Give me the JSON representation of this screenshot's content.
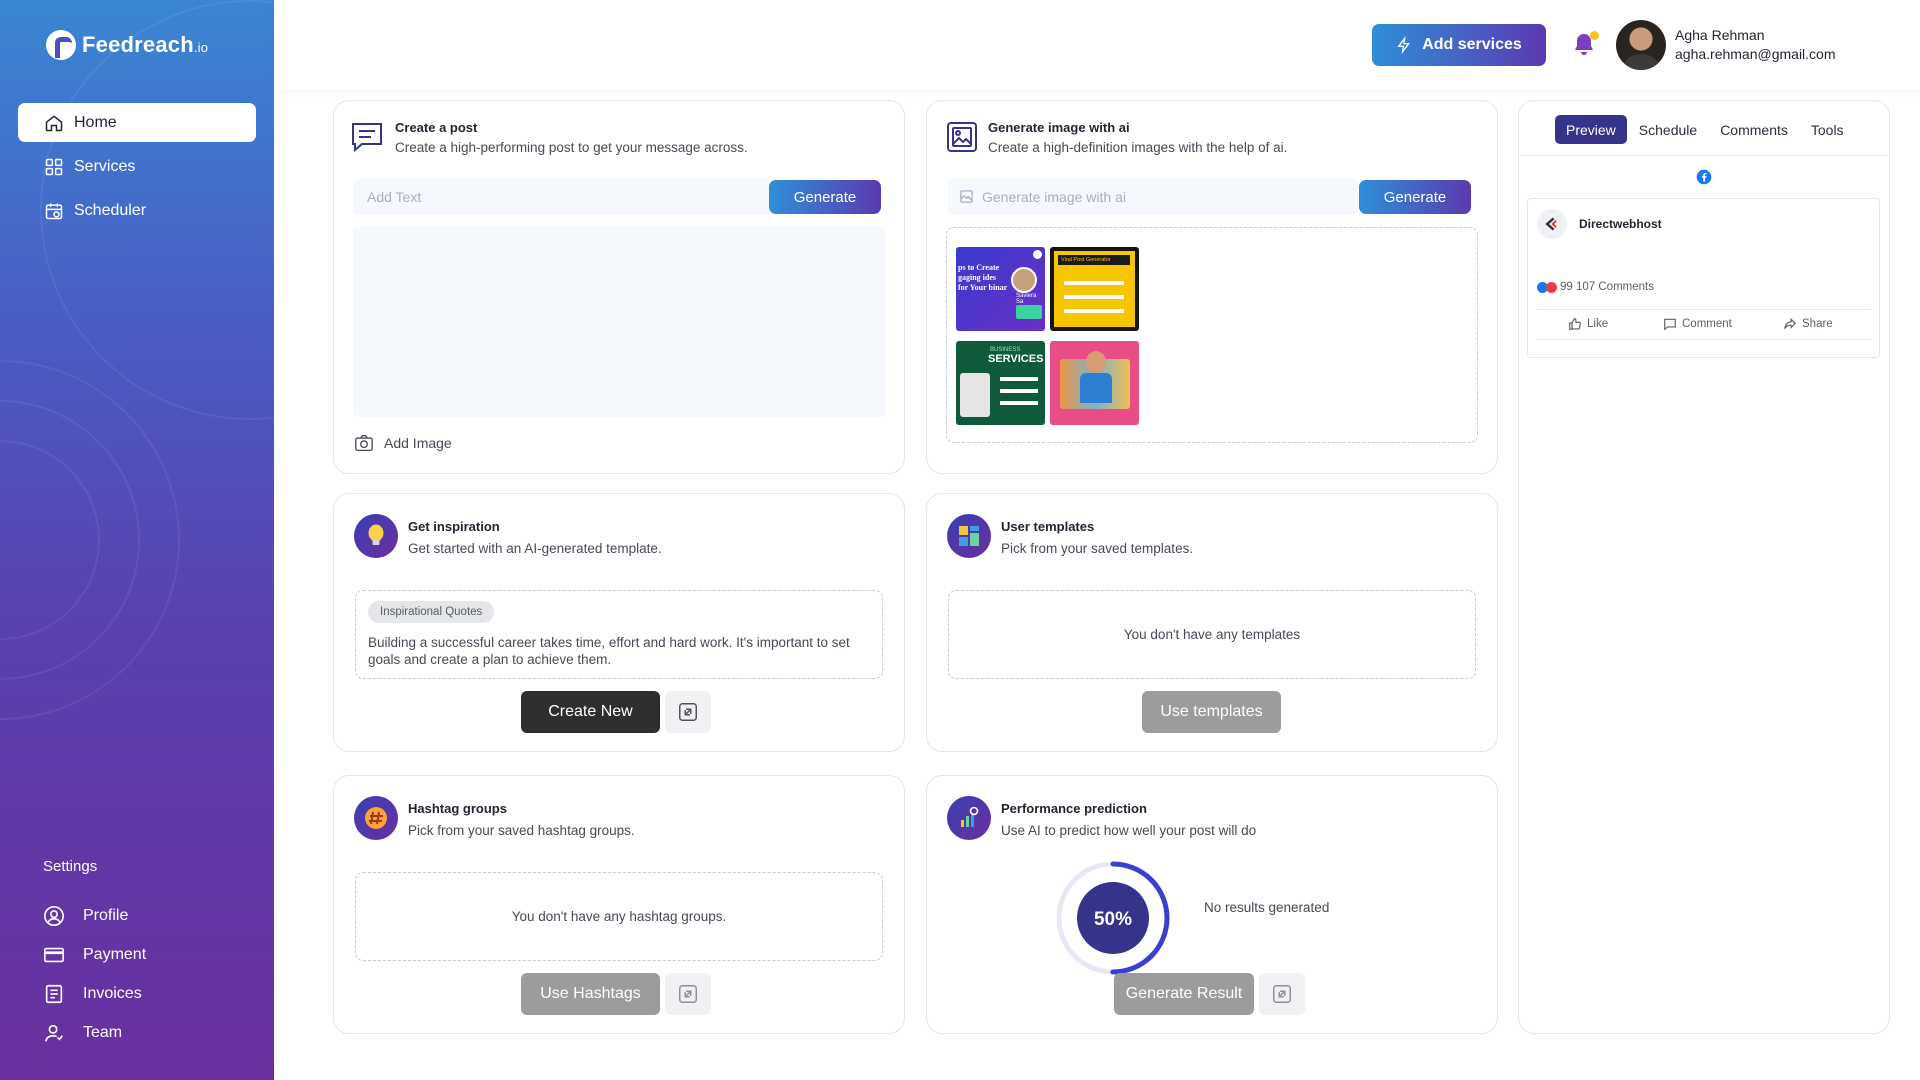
{
  "brand": {
    "name": "Feedreach",
    "tld": ".io"
  },
  "nav": [
    {
      "label": "Home",
      "icon": "home-icon",
      "active": true
    },
    {
      "label": "Services",
      "icon": "grid-icon",
      "active": false
    },
    {
      "label": "Scheduler",
      "icon": "calendar-icon",
      "active": false
    }
  ],
  "settings": {
    "title": "Settings",
    "items": [
      {
        "label": "Profile",
        "icon": "user-circle-icon"
      },
      {
        "label": "Payment",
        "icon": "card-icon"
      },
      {
        "label": "Invoices",
        "icon": "invoice-icon"
      },
      {
        "label": "Team",
        "icon": "team-icon"
      }
    ]
  },
  "header": {
    "add_services_label": "Add services",
    "user_name": "Agha Rehman",
    "user_email": "agha.rehman@gmail.com"
  },
  "create_post": {
    "title": "Create a post",
    "subtitle": "Create a high-performing post to get your message across.",
    "placeholder": "Add Text",
    "generate_label": "Generate",
    "add_image_label": "Add Image"
  },
  "generate_image": {
    "title": "Generate image with ai",
    "subtitle": "Create a high-definition images with the help of ai.",
    "placeholder": "Generate image with ai",
    "generate_label": "Generate",
    "thumb1_text": "ps to Create gaging ides for Your binar",
    "thumb1_name": "Saviera Sa",
    "thumb2_text": "Viral Post Generator",
    "thumb3_kicker": "BUSINESS",
    "thumb3_text": "SERVICES"
  },
  "inspiration": {
    "title": "Get inspiration",
    "subtitle": "Get started with an AI-generated template.",
    "chip": "Inspirational Quotes",
    "quote": "Building a successful career takes time, effort and hard work. It's important to set goals and create a plan to achieve them.",
    "create_new_label": "Create New"
  },
  "user_templates": {
    "title": "User templates",
    "subtitle": "Pick from your saved templates.",
    "empty": "You don't have any templates",
    "button_label": "Use templates"
  },
  "hashtags": {
    "title": "Hashtag groups",
    "subtitle": "Pick from your saved hashtag groups.",
    "empty": "You don't have any hashtag groups.",
    "button_label": "Use Hashtags"
  },
  "performance": {
    "title": "Performance prediction",
    "subtitle": "Use AI to predict how well your post will do",
    "gauge_value": 50,
    "gauge_label": "50%",
    "result_text": "No results generated",
    "button_label": "Generate Result"
  },
  "preview": {
    "tabs": [
      "Preview",
      "Schedule",
      "Comments",
      "Tools"
    ],
    "active_tab": "Preview",
    "page_name": "Directwebhost",
    "reactions_text": "99 107 Comments",
    "actions": [
      "Like",
      "Comment",
      "Share"
    ]
  },
  "colors": {
    "accent_start": "#2f8fd8",
    "accent_end": "#5b39b0",
    "tab_active": "#35348a",
    "facebook": "#1877f2"
  }
}
